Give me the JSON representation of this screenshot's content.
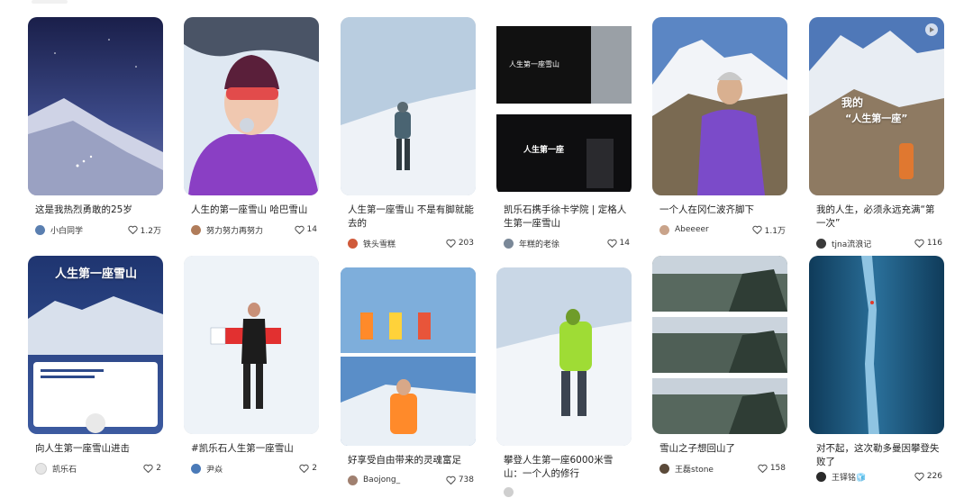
{
  "colors": {
    "text": "#222222",
    "meta": "#333333",
    "heart": "#555555"
  },
  "icons": {
    "like": "heart-outline-icon",
    "play": "play-icon"
  },
  "cards": [
    {
      "title": "这是我热烈勇敢的25岁",
      "author": "小白同学",
      "likes": "1.2万",
      "avatar_color": "#5a7fb0"
    },
    {
      "title": "人生的第一座雪山 哈巴雪山",
      "author": "努力努力再努力",
      "likes": "14",
      "avatar_color": "#b07c5a"
    },
    {
      "title": "人生第一座雪山 不是有脚就能去的",
      "author": "铁头雪糕",
      "likes": "203",
      "avatar_color": "#d05a3a"
    },
    {
      "title": "凯乐石携手徐卡学院 | 定格人生第一座雪山",
      "author": "年糕的老徐",
      "likes": "14",
      "avatar_color": "#7a8898"
    },
    {
      "title": "一个人在冈仁波齐脚下",
      "author": "Abeeeer",
      "likes": "1.1万",
      "avatar_color": "#c9a38a"
    },
    {
      "title": "我的人生，必须永远充满“第一次”",
      "author": "tjna流浪记",
      "likes": "116",
      "avatar_color": "#3a3a3a",
      "overlay": [
        "我的",
        "“人生第一座”"
      ]
    },
    {
      "title": "向人生第一座雪山进击",
      "author": "凯乐石",
      "likes": "2",
      "avatar_color": "#e6e6e6",
      "overlay": [
        "人生第一座雪山"
      ]
    },
    {
      "title": "#凯乐石人生第一座雪山",
      "author": "尹焱",
      "likes": "2",
      "avatar_color": "#4a7ab8"
    },
    {
      "title": "好享受自由带来的灵魂富足",
      "author": "Baojong_",
      "likes": "738",
      "avatar_color": "#a08070"
    },
    {
      "title": "攀登人生第一座6000米雪山：一个人的修行",
      "author": "",
      "likes": "",
      "avatar_color": "#cfcfcf"
    },
    {
      "title": "雪山之子想回山了",
      "author": "王磊stone",
      "likes": "158",
      "avatar_color": "#5b4a3a"
    },
    {
      "title": "对不起，这次勒多曼因攀登失败了",
      "author": "王铎铭🧊",
      "likes": "226",
      "avatar_color": "#2a2a2a"
    }
  ]
}
